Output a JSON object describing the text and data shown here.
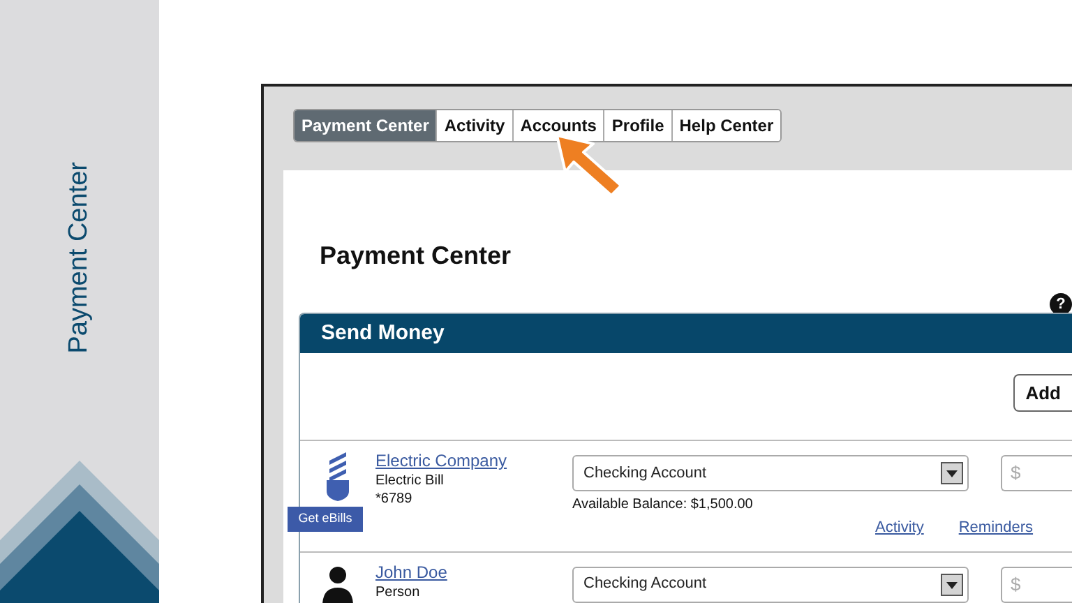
{
  "sidebar": {
    "title": "Payment Center"
  },
  "tabs": [
    {
      "label": "Payment Center",
      "selected": true
    },
    {
      "label": "Activity",
      "selected": false
    },
    {
      "label": "Accounts",
      "selected": false
    },
    {
      "label": "Profile",
      "selected": false
    },
    {
      "label": "Help Center",
      "selected": false
    }
  ],
  "page": {
    "title": "Payment Center",
    "help_icon": "?"
  },
  "send_money": {
    "title": "Send Money",
    "add_button": "Add",
    "payees": [
      {
        "kind": "biller",
        "name": "Electric Company",
        "type": "Electric Bill",
        "account": "*6789",
        "ebills_button": "Get eBills",
        "funding_account": "Checking Account",
        "balance": "Available Balance: $1,500.00",
        "amount_placeholder": "$",
        "links": [
          "Activity",
          "Reminders"
        ]
      },
      {
        "kind": "person",
        "name": "John Doe",
        "type": "Person",
        "funding_account": "Checking Account",
        "amount_placeholder": "$"
      }
    ]
  }
}
